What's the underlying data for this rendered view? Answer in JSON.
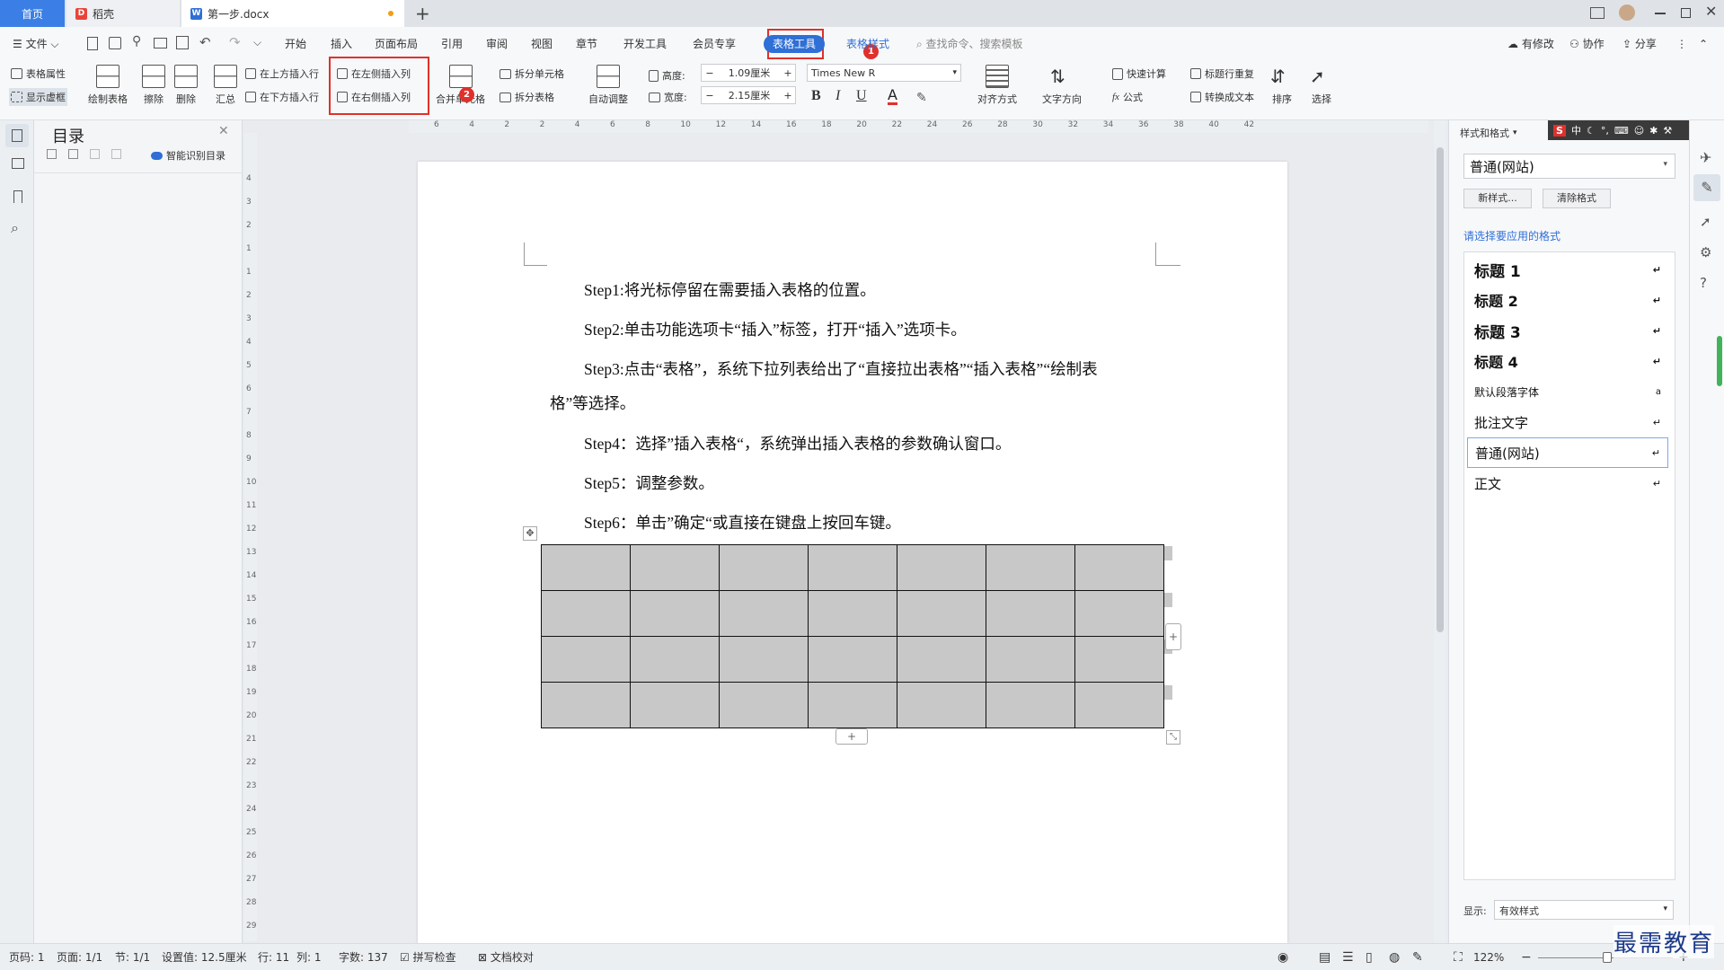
{
  "titlebar": {
    "tab_home": "首页",
    "tab_daoke": "稻壳",
    "tab_doc": "第一步.docx",
    "new_tab": "+"
  },
  "menu": {
    "file": "文件",
    "items": [
      "开始",
      "插入",
      "页面布局",
      "引用",
      "审阅",
      "视图",
      "章节",
      "开发工具",
      "会员专享"
    ],
    "table_tools": "表格工具",
    "table_style": "表格样式",
    "search": "查找命令、搜索模板",
    "modified": "有修改",
    "collab": "协作",
    "share": "分享"
  },
  "ribbon": {
    "table_props": "表格属性",
    "show_grid": "显示虚框",
    "draw_table": "绘制表格",
    "erase": "擦除",
    "delete": "删除",
    "summary": "汇总",
    "insert_above": "在上方插入行",
    "insert_below": "在下方插入行",
    "insert_left": "在左侧插入列",
    "insert_right": "在右侧插入列",
    "merge": "合并单元格",
    "split_cell": "拆分单元格",
    "split_table": "拆分表格",
    "auto_adjust": "自动调整",
    "height_label": "高度:",
    "height_value": "1.09厘米",
    "width_label": "宽度:",
    "width_value": "2.15厘米",
    "font": "Times New R",
    "bold": "B",
    "italic": "I",
    "underline": "U",
    "font_color": "A",
    "align": "对齐方式",
    "text_dir": "文字方向",
    "quick_calc": "快速计算",
    "formula": "公式",
    "repeat_title": "标题行重复",
    "to_text": "转换成文本",
    "sort": "排序",
    "select": "选择"
  },
  "badges": {
    "one": "1",
    "two": "2"
  },
  "toc": {
    "title": "目录",
    "smart": "智能识别目录"
  },
  "ruler_h": [
    "6",
    "4",
    "2",
    "2",
    "4",
    "6",
    "8",
    "10",
    "12",
    "14",
    "16",
    "18",
    "20",
    "22",
    "24",
    "26",
    "28",
    "30",
    "32",
    "34",
    "36",
    "38",
    "40",
    "42"
  ],
  "ruler_v": [
    "4",
    "3",
    "2",
    "1",
    "1",
    "2",
    "3",
    "4",
    "5",
    "6",
    "7",
    "8",
    "9",
    "10",
    "11",
    "12",
    "13",
    "14",
    "15",
    "16",
    "17",
    "18",
    "19",
    "20",
    "21",
    "22",
    "23",
    "24",
    "25",
    "26",
    "27",
    "28",
    "29"
  ],
  "doc": {
    "paragraphs": [
      "Step1:将光标停留在需要插入表格的位置。",
      "Step2:单击功能选项卡“插入”标签，打开“插入”选项卡。",
      "Step3:点击“表格”，系统下拉列表给出了“直接拉出表格”“插入表格”“绘制表",
      "格”等选择。",
      "Step4：选择”插入表格“，系统弹出插入表格的参数确认窗口。",
      "Step5：调整参数。",
      "Step6：单击”确定“或直接在键盘上按回车键。"
    ],
    "table": {
      "rows": 4,
      "cols": 7
    }
  },
  "styles": {
    "header": "样式和格式",
    "current": "普通(网站)",
    "new_style": "新样式...",
    "clear": "清除格式",
    "apply_label": "请选择要应用的格式",
    "list": [
      "标题 1",
      "标题 2",
      "标题 3",
      "标题 4",
      "默认段落字体",
      "批注文字",
      "普通(网站)",
      "正文"
    ],
    "show_label": "显示:",
    "show_value": "有效样式"
  },
  "ime": {
    "s": "S",
    "zh": "中"
  },
  "status": {
    "page": "页码: 1",
    "pages": "页面: 1/1",
    "section": "节: 1/1",
    "setting": "设置值: 12.5厘米",
    "row": "行: 11",
    "col": "列: 1",
    "words": "字数: 137",
    "spell": "拼写检查",
    "proof": "文档校对",
    "zoom": "122%"
  },
  "watermark": "最需教育"
}
